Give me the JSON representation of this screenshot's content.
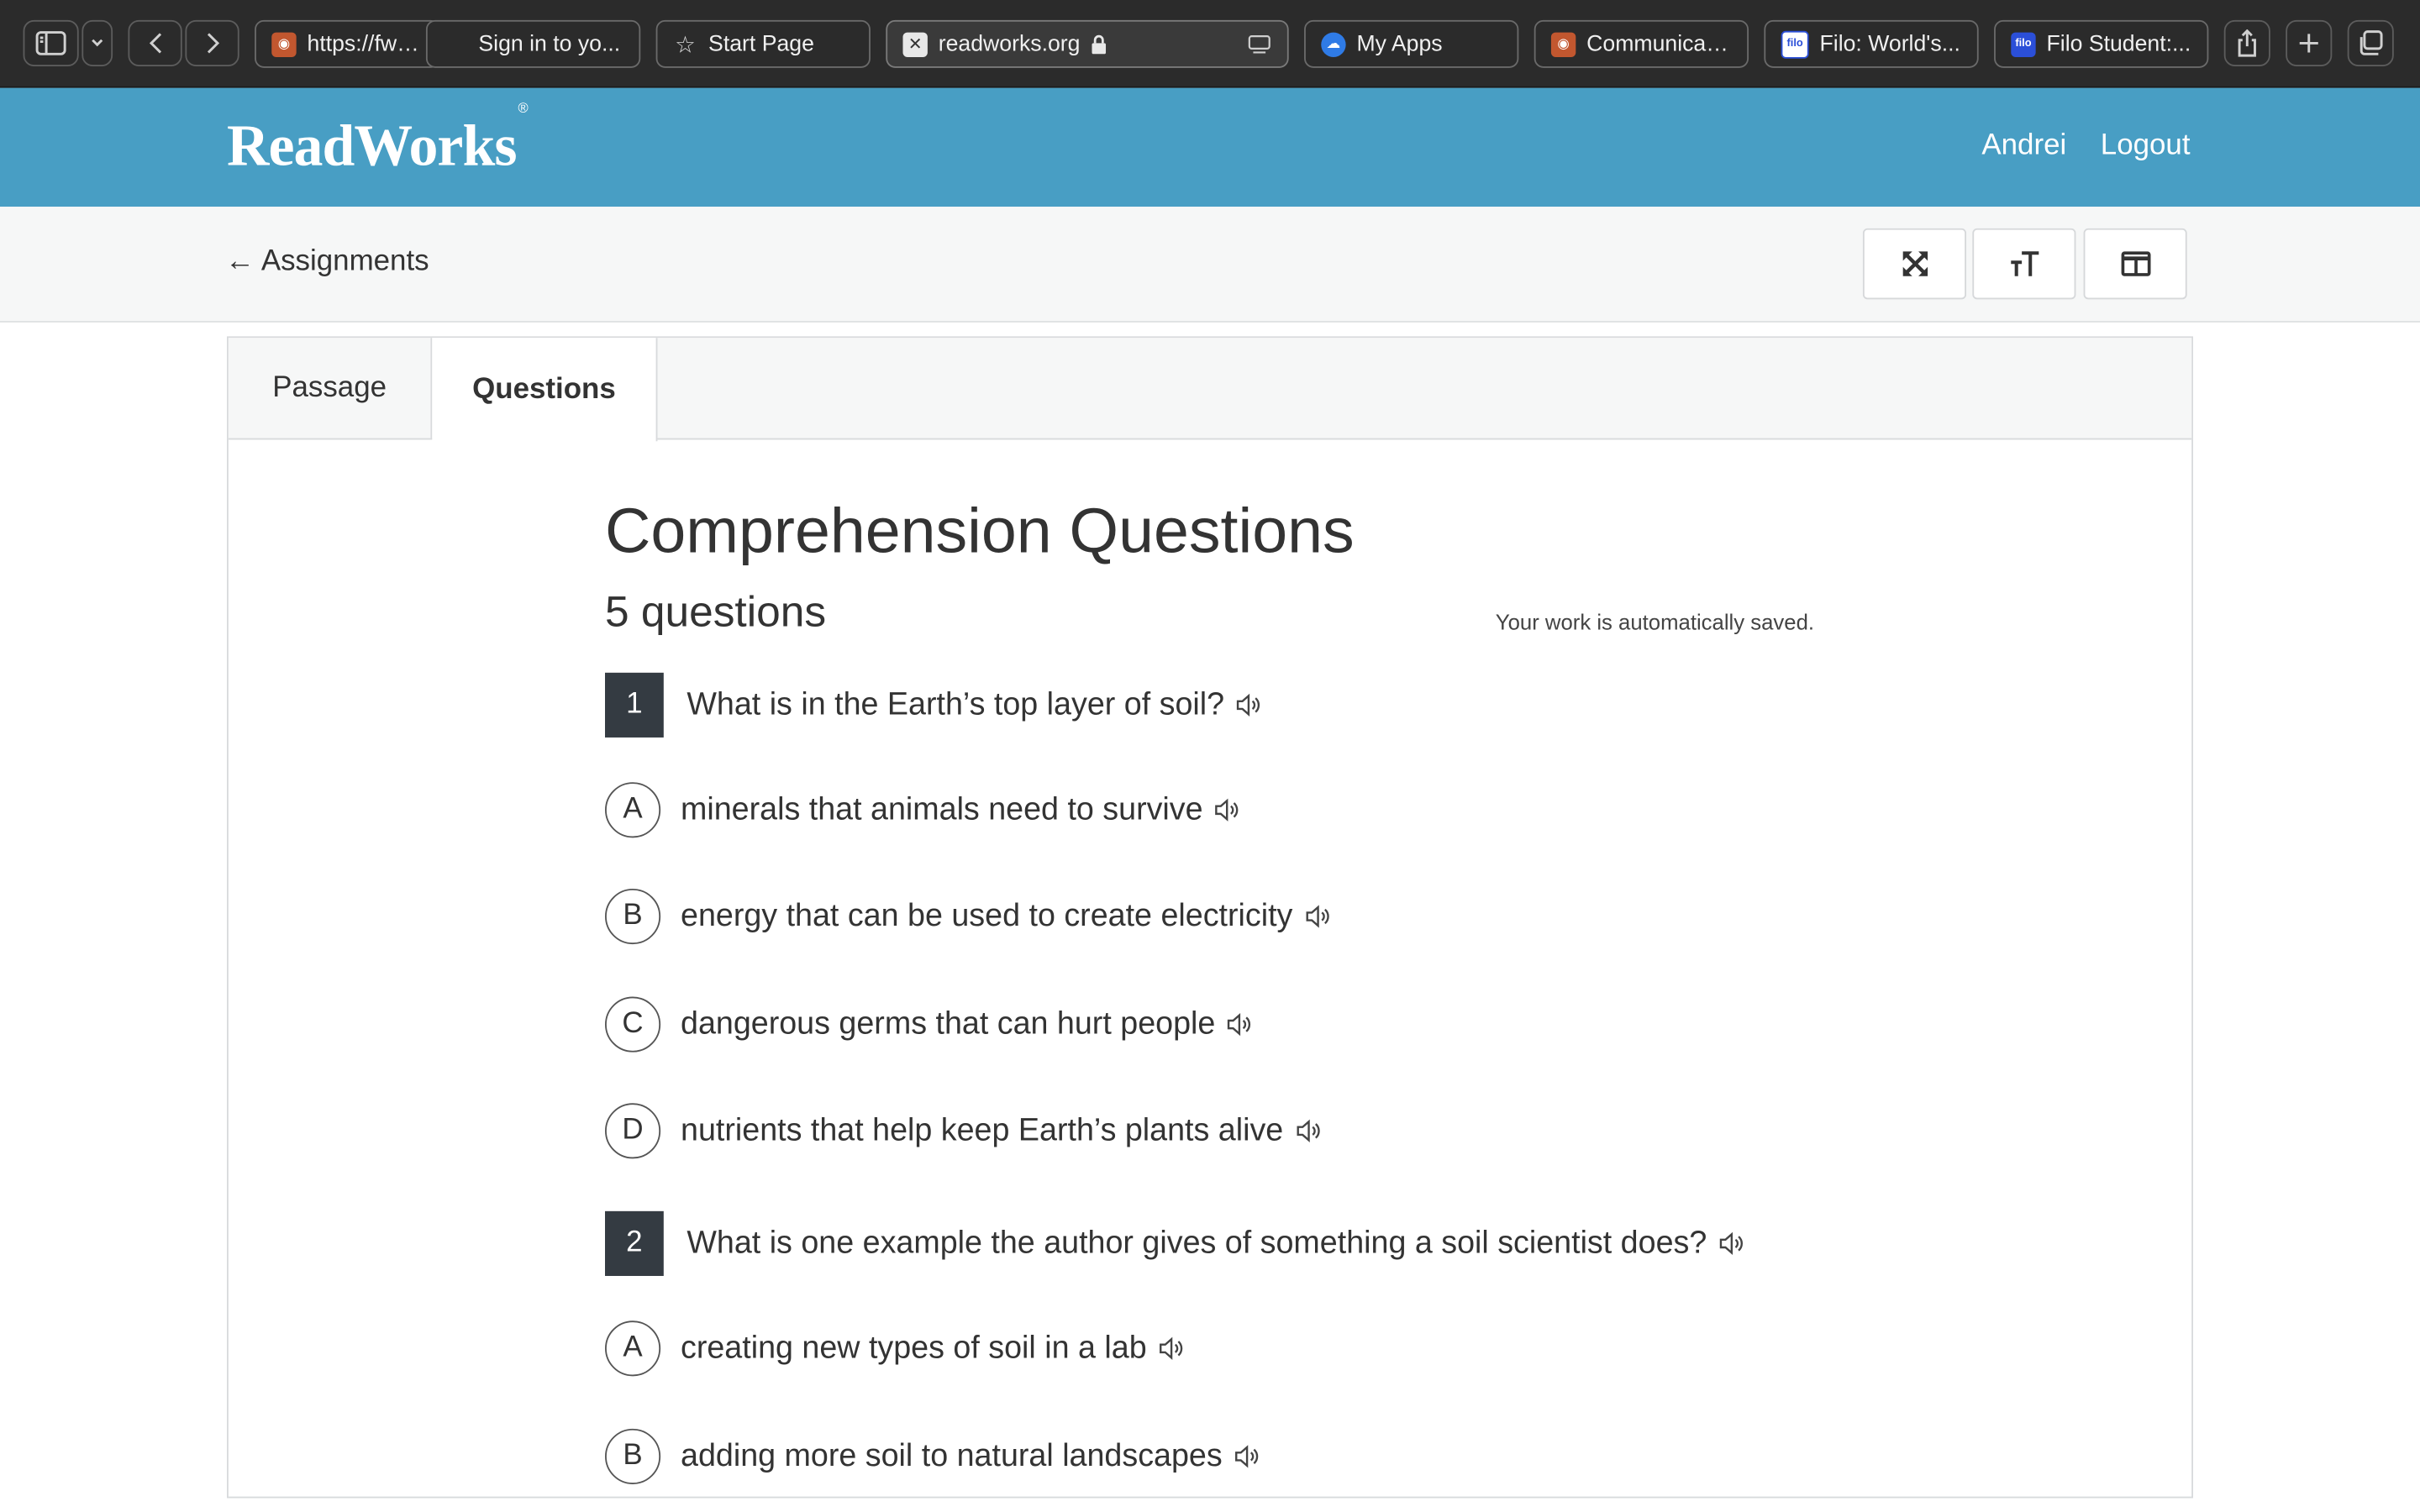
{
  "browser": {
    "tabs": [
      {
        "label": "https://fwisd",
        "icon": "owl-icon"
      },
      {
        "label": "Sign in to yo...",
        "icon": "microsoft-icon"
      },
      {
        "label": "Start Page",
        "icon": "star-icon"
      },
      {
        "label": "readworks.org",
        "icon": "close-icon"
      },
      {
        "label": "My Apps",
        "icon": "cloud-icon"
      },
      {
        "label": "Communicati...",
        "icon": "owl-icon"
      },
      {
        "label": "Filo: World's...",
        "icon": "filo-icon"
      },
      {
        "label": "Filo Student:...",
        "icon": "filo-icon"
      }
    ],
    "filo_text": "filo"
  },
  "header": {
    "logo": "ReadWorks",
    "logo_mark": "®",
    "user": "Andrei",
    "logout": "Logout",
    "brand_color": "#489ec4"
  },
  "toolbar": {
    "back_label": "← Assignments",
    "buttons": [
      "expand-icon",
      "text-size-icon",
      "split-view-icon"
    ]
  },
  "content": {
    "tabs": [
      {
        "label": "Passage",
        "active": false
      },
      {
        "label": "Questions",
        "active": true
      }
    ],
    "title": "Comprehension Questions",
    "count": "5 questions",
    "saved_note": "Your work is automatically saved.",
    "questions": [
      {
        "number": "1",
        "text": "What is in the Earth’s top layer of soil?",
        "options": [
          {
            "letter": "A",
            "text": "minerals that animals need to survive"
          },
          {
            "letter": "B",
            "text": "energy that can be used to create electricity"
          },
          {
            "letter": "C",
            "text": "dangerous germs that can hurt people"
          },
          {
            "letter": "D",
            "text": "nutrients that help keep Earth’s plants alive"
          }
        ]
      },
      {
        "number": "2",
        "text": "What is one example the author gives of something a soil scientist does?",
        "options": [
          {
            "letter": "A",
            "text": "creating new types of soil in a lab"
          },
          {
            "letter": "B",
            "text": "adding more soil to natural landscapes"
          }
        ]
      }
    ]
  }
}
